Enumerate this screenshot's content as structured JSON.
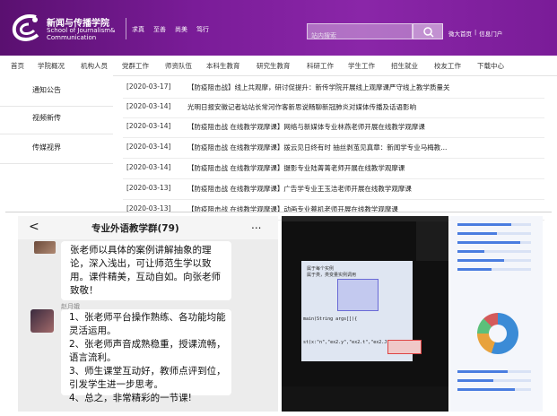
{
  "header": {
    "logo_cn": "新闻与传播学院",
    "logo_en_1": "School of Journalism&",
    "logo_en_2": "Communication",
    "top_links": [
      "求真",
      "至善",
      "尚美",
      "笃行"
    ],
    "search_placeholder": "站内搜索",
    "links": [
      "微大首页",
      "|",
      "信息门户"
    ]
  },
  "nav": [
    "首页",
    "学院概况",
    "机构人员",
    "党群工作",
    "师资队伍",
    "本科生教育",
    "研究生教育",
    "科研工作",
    "学生工作",
    "招生就业",
    "校友工作",
    "下载中心"
  ],
  "sidebar": [
    "通知公告",
    "视频新传",
    "传媒视界"
  ],
  "news": [
    {
      "date": "[2020-03-17]",
      "title": "【防疫阻击战】线上共观摩，研讨促提升：新传学院开展线上观摩课严守线上教学质量关"
    },
    {
      "date": "[2020-03-14]",
      "title": "光明日报安徽记者站站长常河作客新思说畅聊新冠肺炎对媒体传播及话语影响"
    },
    {
      "date": "[2020-03-14]",
      "title": "【防疫阻击战 在线教学观摩课】网络与新媒体专业林燕老师开展在线教学观摩课"
    },
    {
      "date": "[2020-03-14]",
      "title": "【防疫阻击战 在线教学观摩课】拨云见日终有时 抽丝剥茧见真章：新闻学专业马梅教..."
    },
    {
      "date": "[2020-03-14]",
      "title": "【防疫阻击战 在线教学观摩课】摄影专业陆菁菁老师开展在线教学观摩课"
    },
    {
      "date": "[2020-03-13]",
      "title": "【防疫阻击战 在线教学观摩课】广告学专业王玉洁老师开展在线教学观摩课"
    },
    {
      "date": "[2020-03-13]",
      "title": "【防疫阻击战 在线教学观摩课】动画专业蔡机老师开展在线教学观摩课"
    }
  ],
  "chat": {
    "back": "<",
    "title": "专业外语教学群(79)",
    "more": "...",
    "msg1": "张老师以具体的案例讲解抽象的理论，深入浅出，可让师范生学以致用。课件精美，互动自如。向张老师致敬！",
    "sender": "赵月娥",
    "msg2": "1、张老师平台操作熟练、各功能均能灵活运用。\n2、张老师声音成熟稳重，授课流畅，语言流利。\n3、师生课堂互动好，教师点评到位，引发学生进一步思考。\n4、总之，非常精彩的一节课!"
  },
  "slide": {
    "heading": "属于每个实例\n属于类，类变量实例调用",
    "code": "main(String args[]){",
    "code2": "st(x:\"n\",\"ex2.y\",\"ex2.t\",\"ex2.J\");"
  }
}
